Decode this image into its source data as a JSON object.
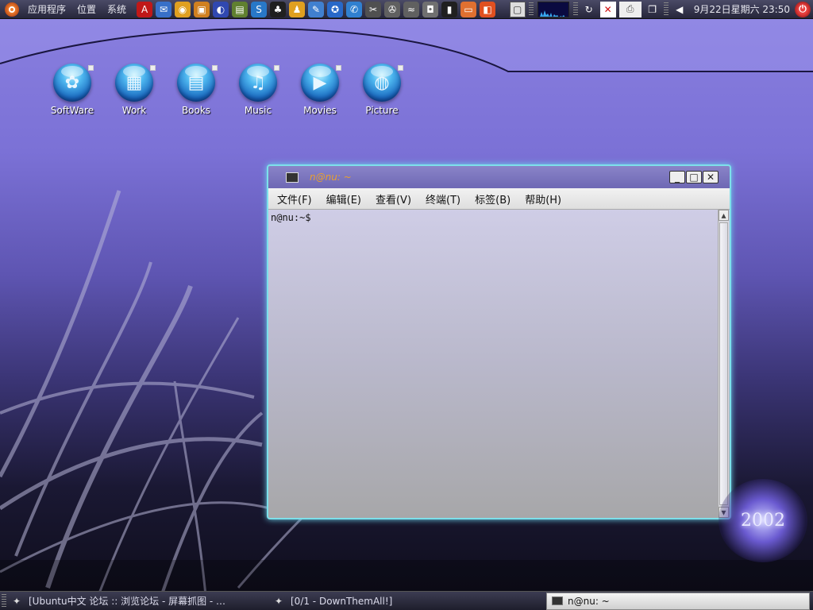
{
  "top_panel": {
    "menus": [
      "应用程序",
      "位置",
      "系统"
    ],
    "launchers": [
      {
        "icon": "acrobat-icon",
        "glyph": "A",
        "color": "#c01818"
      },
      {
        "icon": "thunderbird-icon",
        "glyph": "✉",
        "color": "#3870c8"
      },
      {
        "icon": "picasa-icon",
        "glyph": "◉",
        "color": "#e0a020"
      },
      {
        "icon": "package-icon",
        "glyph": "▣",
        "color": "#d08020"
      },
      {
        "icon": "globe-icon",
        "glyph": "◐",
        "color": "#3048b0"
      },
      {
        "icon": "books-icon",
        "glyph": "▤",
        "color": "#608030"
      },
      {
        "icon": "skype-icon",
        "glyph": "S",
        "color": "#2878c8"
      },
      {
        "icon": "qq-penguin-icon",
        "glyph": "♣",
        "color": "#202020"
      },
      {
        "icon": "person-icon",
        "glyph": "♟",
        "color": "#e0a020"
      },
      {
        "icon": "brush-icon",
        "glyph": "✎",
        "color": "#4080d0"
      },
      {
        "icon": "safari-compass-icon",
        "glyph": "✪",
        "color": "#2868c8"
      },
      {
        "icon": "chat-icon",
        "glyph": "✆",
        "color": "#3080d0"
      },
      {
        "icon": "tools-icon",
        "glyph": "✂",
        "color": "#505050"
      },
      {
        "icon": "film-reel-icon",
        "glyph": "✇",
        "color": "#606060"
      },
      {
        "icon": "fish-icon",
        "glyph": "≈",
        "color": "#606060"
      },
      {
        "icon": "camera-icon",
        "glyph": "◘",
        "color": "#707070"
      },
      {
        "icon": "terminal-icon",
        "glyph": "▮",
        "color": "#202020"
      },
      {
        "icon": "folder-icon",
        "glyph": "▭",
        "color": "#e07030"
      },
      {
        "icon": "bag-icon",
        "glyph": "◧",
        "color": "#e05020"
      }
    ],
    "tray": [
      {
        "icon": "screen-icon",
        "glyph": "▢"
      },
      {
        "icon": "sync-icon",
        "glyph": "↻"
      },
      {
        "icon": "close-red-icon",
        "glyph": "✕"
      },
      {
        "icon": "printer-icon",
        "glyph": "⎙"
      },
      {
        "icon": "windows-icon",
        "glyph": "❐"
      },
      {
        "icon": "volume-icon",
        "glyph": "◀"
      }
    ],
    "clock": "9月22日星期六 23:50"
  },
  "desktop_icons": [
    {
      "label": "SoftWare",
      "icon": "software-icon",
      "glyph": "✿"
    },
    {
      "label": "Work",
      "icon": "work-icon",
      "glyph": "▦"
    },
    {
      "label": "Books",
      "icon": "books-icon",
      "glyph": "▤"
    },
    {
      "label": "Music",
      "icon": "music-icon",
      "glyph": "♫"
    },
    {
      "label": "Movies",
      "icon": "movies-icon",
      "glyph": "▶"
    },
    {
      "label": "Picture",
      "icon": "picture-icon",
      "glyph": "◍"
    }
  ],
  "terminal": {
    "title": "n@nu: ~",
    "menus": [
      "文件(F)",
      "编辑(E)",
      "查看(V)",
      "终端(T)",
      "标签(B)",
      "帮助(H)"
    ],
    "prompt": "n@nu:~$",
    "buttons": {
      "minimize": "_",
      "maximize": "□",
      "close": "✕"
    }
  },
  "logo": {
    "text": "2002"
  },
  "taskbar": {
    "tasks": [
      {
        "label": "[Ubuntu中文 论坛 :: 浏览论坛 - 屏幕抓图 - …",
        "icon": "firefox-icon"
      },
      {
        "label": "[0/1 - DownThemAll!]",
        "icon": "firefox-icon"
      }
    ],
    "active_task": {
      "label": "n@nu: ~",
      "icon": "terminal-icon"
    }
  }
}
